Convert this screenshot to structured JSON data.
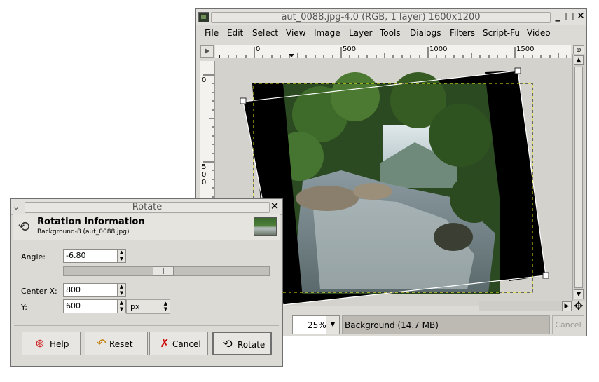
{
  "image_window": {
    "title": "aut_0088.jpg-4.0 (RGB, 1 layer) 1600x1200",
    "menus": [
      "File",
      "Edit",
      "Select",
      "View",
      "Image",
      "Layer",
      "Tools",
      "Dialogs",
      "Filters",
      "Script-Fu",
      "Video"
    ],
    "hruler_labels": [
      "0",
      "500",
      "1000",
      "1500"
    ],
    "vruler_labels": [
      "0",
      "5",
      "0",
      "0"
    ],
    "zoom": "25%",
    "status": "Background (14.7 MB)",
    "cancel_label": "Cancel",
    "window_buttons": [
      "_",
      "□",
      "✕"
    ]
  },
  "rotate_dialog": {
    "title": "Rotate",
    "header_title": "Rotation Information",
    "header_subtitle": "Background-8 (aut_0088.jpg)",
    "angle_label": "Angle:",
    "angle_value": "-6.80",
    "center_x_label": "Center X:",
    "center_x_value": "800",
    "y_label": "Y:",
    "y_value": "600",
    "unit": "px",
    "buttons": {
      "help": "Help",
      "reset": "Reset",
      "cancel": "Cancel",
      "rotate": "Rotate"
    }
  },
  "icons": {
    "help_icon": "lifebuoy",
    "reset_icon": "revert",
    "cancel_icon": "red-x",
    "rotate_icon": "rotate-tool",
    "nav_icon": "navigate-cross"
  },
  "colors": {
    "cancel_x": "#cc0000",
    "selection_dash": "#e8e800"
  }
}
